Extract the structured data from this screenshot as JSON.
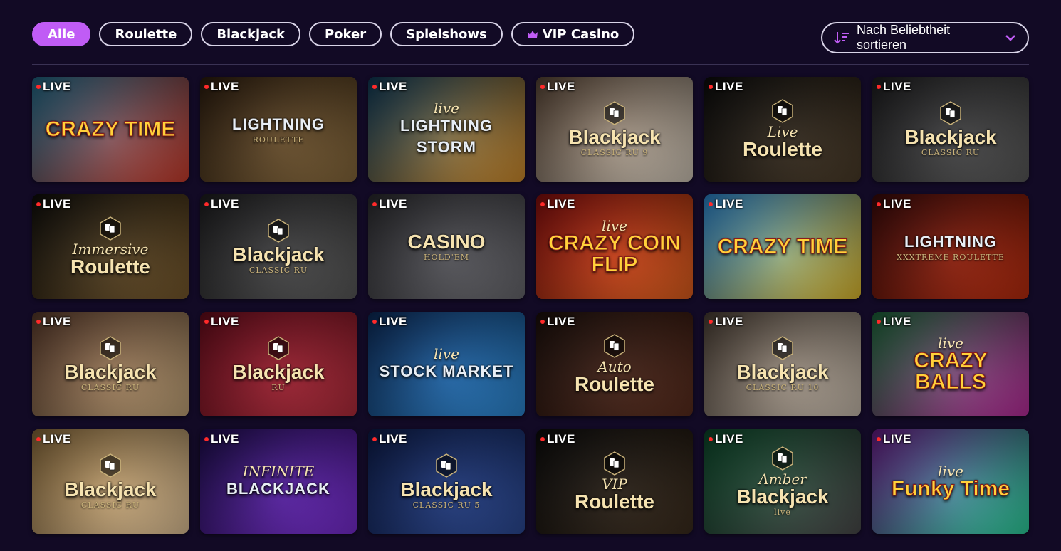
{
  "filters": [
    {
      "label": "Alle",
      "active": true
    },
    {
      "label": "Roulette",
      "active": false
    },
    {
      "label": "Blackjack",
      "active": false
    },
    {
      "label": "Poker",
      "active": false
    },
    {
      "label": "Spielshows",
      "active": false
    },
    {
      "label": "VIP Casino",
      "active": false,
      "icon": "crown-icon"
    }
  ],
  "sort": {
    "label": "Nach Beliebtheit sortieren",
    "icon": "sort-icon"
  },
  "badge": "LIVE",
  "colors": {
    "accent": "#c05cf5",
    "background": "#120a25",
    "live_dot": "#ff2a2a"
  },
  "games": [
    {
      "name": "crazy-time",
      "main": "CRAZY TIME",
      "style": "fun",
      "bg": "#1e6a8a",
      "bg2": "#d13b2a"
    },
    {
      "name": "lightning-roulette",
      "main": "LIGHTNING",
      "foot": "ROULETTE",
      "style": "chrome",
      "bg": "#2a1a0c",
      "bg2": "#8a6a3a"
    },
    {
      "name": "lightning-storm",
      "main": "LIGHTNING STORM",
      "sub": "live",
      "style": "chrome",
      "bg": "#0c3a5a",
      "bg2": "#d8902a"
    },
    {
      "name": "blackjack-classic-ru-9",
      "main": "Blackjack",
      "foot": "CLASSIC RU 9",
      "icon": true,
      "style": "gold",
      "bg": "#5a4636",
      "bg2": "#d8cdbd"
    },
    {
      "name": "live-roulette",
      "sub": "Live",
      "main": "Roulette",
      "icon": true,
      "style": "gold",
      "bg": "#0a0a0a",
      "bg2": "#4a3a26"
    },
    {
      "name": "blackjack-classic-ru",
      "main": "Blackjack",
      "foot": "CLASSIC RU",
      "icon": true,
      "style": "gold",
      "bg": "#1c1c1e",
      "bg2": "#5a5a5a"
    },
    {
      "name": "immersive-roulette",
      "sub": "Immersive",
      "main": "Roulette",
      "icon": true,
      "style": "gold",
      "bg": "#0c0b08",
      "bg2": "#7a5a2a"
    },
    {
      "name": "blackjack-classic-ru-b",
      "main": "Blackjack",
      "foot": "CLASSIC RU",
      "icon": true,
      "style": "gold",
      "bg": "#1c1c1e",
      "bg2": "#5a5a5a"
    },
    {
      "name": "casino-holdem",
      "main": "CASINO",
      "foot": "HOLD'EM",
      "style": "gold",
      "bg": "#2a2a2e",
      "bg2": "#6a6a70"
    },
    {
      "name": "crazy-coin-flip",
      "sub": "live",
      "main": "CRAZY COIN FLIP",
      "style": "fun",
      "bg": "#8a0c0c",
      "bg2": "#e8601a"
    },
    {
      "name": "crazy-time-b",
      "main": "CRAZY TIME",
      "style": "fun",
      "bg": "#2a8ad8",
      "bg2": "#e8c02a"
    },
    {
      "name": "xxxtreme-lightning-roulette",
      "main": "LIGHTNING",
      "foot": "XXXTREME ROULETTE",
      "style": "chrome",
      "bg": "#3a0808",
      "bg2": "#c02a0a"
    },
    {
      "name": "blackjack-classic-ru-dealer",
      "main": "Blackjack",
      "foot": "CLASSIC RU",
      "icon": true,
      "style": "gold",
      "bg": "#5a3a2a",
      "bg2": "#c8a87a"
    },
    {
      "name": "blackjack-ru",
      "main": "Blackjack",
      "foot": "RU",
      "icon": true,
      "style": "gold",
      "bg": "#6a0a1a",
      "bg2": "#b82a3a"
    },
    {
      "name": "stock-market",
      "main": "STOCK MARKET",
      "sub": "live",
      "style": "chrome",
      "bg": "#0a2a5a",
      "bg2": "#2a8ad8"
    },
    {
      "name": "auto-roulette",
      "sub": "Auto",
      "main": "Roulette",
      "icon": true,
      "style": "gold",
      "bg": "#1a0e0a",
      "bg2": "#5a2a1a"
    },
    {
      "name": "blackjack-classic-ru-10",
      "main": "Blackjack",
      "foot": "CLASSIC RU 10",
      "icon": true,
      "style": "gold",
      "bg": "#4a3e34",
      "bg2": "#cfc2b2"
    },
    {
      "name": "crazy-balls",
      "main": "CRAZY BALLS",
      "sub": "live",
      "style": "fun",
      "bg": "#1a6a3a",
      "bg2": "#c02aa0"
    },
    {
      "name": "blackjack-classic-ru-gold",
      "main": "Blackjack",
      "foot": "CLASSIC RU",
      "icon": true,
      "style": "gold",
      "bg": "#8a6a3a",
      "bg2": "#e8c89a"
    },
    {
      "name": "infinite-blackjack",
      "main": "BLACKJACK",
      "sub": "INFINITE",
      "style": "chrome",
      "bg": "#1a0a4a",
      "bg2": "#7a2ad8"
    },
    {
      "name": "blackjack-classic-ru-5",
      "main": "Blackjack",
      "foot": "CLASSIC RU 5",
      "icon": true,
      "style": "gold",
      "bg": "#0a1a4a",
      "bg2": "#2a4a9a"
    },
    {
      "name": "vip-roulette",
      "sub": "VIP",
      "main": "Roulette",
      "icon": true,
      "style": "gold",
      "bg": "#0a0a0a",
      "bg2": "#3a2a1a"
    },
    {
      "name": "amber-blackjack",
      "sub": "Amber",
      "main": "Blackjack",
      "foot": "live",
      "icon": true,
      "style": "gold",
      "bg": "#0a4a2a",
      "bg2": "#4a4a4a"
    },
    {
      "name": "funky-time",
      "main": "Funky Time",
      "sub": "live",
      "style": "fun",
      "bg": "#6a1a8a",
      "bg2": "#2ad8a0"
    }
  ]
}
